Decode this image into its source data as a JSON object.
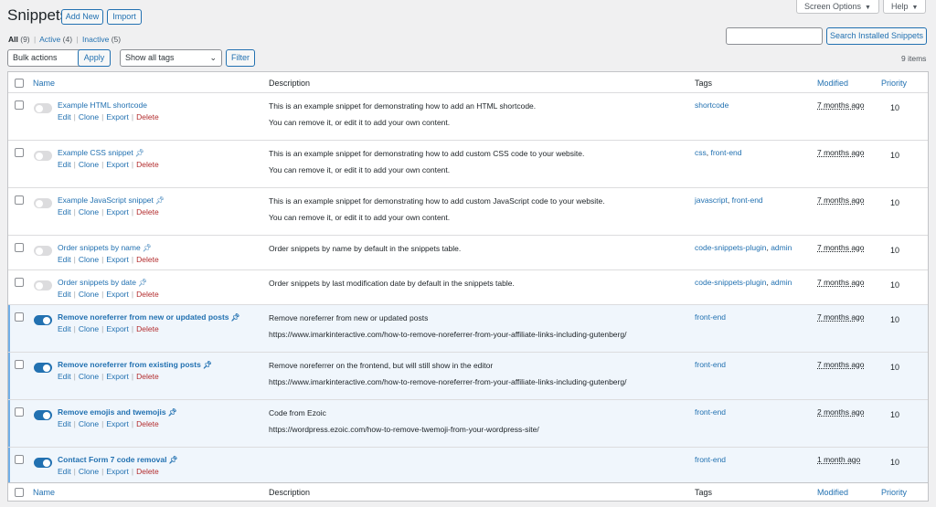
{
  "header": {
    "title": "Snippets",
    "add_new": "Add New",
    "import": "Import",
    "screen_options": "Screen Options",
    "help": "Help"
  },
  "views": {
    "all": "All",
    "all_count": "(9)",
    "active": "Active",
    "active_count": "(4)",
    "inactive": "Inactive",
    "inactive_count": "(5)"
  },
  "search": {
    "value": "",
    "button": "Search Installed Snippets"
  },
  "filters": {
    "bulk_actions": "Bulk actions",
    "apply": "Apply",
    "tags": "Show all tags",
    "filter": "Filter",
    "items_count": "9 items"
  },
  "columns": {
    "name": "Name",
    "description": "Description",
    "tags": "Tags",
    "modified": "Modified",
    "priority": "Priority"
  },
  "row_actions": {
    "edit": "Edit",
    "clone": "Clone",
    "export": "Export",
    "delete": "Delete"
  },
  "snippets": [
    {
      "name": "Example HTML shortcode",
      "active": false,
      "pinned": false,
      "desc1": "This is an example snippet for demonstrating how to add an HTML shortcode.",
      "desc2": "You can remove it, or edit it to add your own content.",
      "tag1": "shortcode",
      "tag2": "",
      "modified": "7 months ago",
      "priority": "10"
    },
    {
      "name": "Example CSS snippet",
      "active": false,
      "pinned": true,
      "desc1": "This is an example snippet for demonstrating how to add custom CSS code to your website.",
      "desc2": "You can remove it, or edit it to add your own content.",
      "tag1": "css",
      "tag2": "front-end",
      "modified": "7 months ago",
      "priority": "10"
    },
    {
      "name": "Example JavaScript snippet",
      "active": false,
      "pinned": true,
      "desc1": "This is an example snippet for demonstrating how to add custom JavaScript code to your website.",
      "desc2": "You can remove it, or edit it to add your own content.",
      "tag1": "javascript",
      "tag2": "front-end",
      "modified": "7 months ago",
      "priority": "10"
    },
    {
      "name": "Order snippets by name",
      "active": false,
      "pinned": true,
      "desc1": "Order snippets by name by default in the snippets table.",
      "desc2": "",
      "tag1": "code-snippets-plugin",
      "tag2": "admin",
      "modified": "7 months ago",
      "priority": "10"
    },
    {
      "name": "Order snippets by date",
      "active": false,
      "pinned": true,
      "desc1": "Order snippets by last modification date by default in the snippets table.",
      "desc2": "",
      "tag1": "code-snippets-plugin",
      "tag2": "admin",
      "modified": "7 months ago",
      "priority": "10"
    },
    {
      "name": "Remove noreferrer from new or updated posts",
      "active": true,
      "pinned": true,
      "desc1": "Remove noreferrer from new or updated posts",
      "desc2": "https://www.imarkinteractive.com/how-to-remove-noreferrer-from-your-affiliate-links-including-gutenberg/",
      "tag1": "front-end",
      "tag2": "",
      "modified": "7 months ago",
      "priority": "10"
    },
    {
      "name": "Remove noreferrer from existing posts",
      "active": true,
      "pinned": true,
      "desc1": "Remove noreferrer on the frontend, but will still show in the editor",
      "desc2": "https://www.imarkinteractive.com/how-to-remove-noreferrer-from-your-affiliate-links-including-gutenberg/",
      "tag1": "front-end",
      "tag2": "",
      "modified": "7 months ago",
      "priority": "10"
    },
    {
      "name": "Remove emojis and twemojis",
      "active": true,
      "pinned": true,
      "desc1": "Code from Ezoic",
      "desc2": "https://wordpress.ezoic.com/how-to-remove-twemoji-from-your-wordpress-site/",
      "tag1": "front-end",
      "tag2": "",
      "modified": "2 months ago",
      "priority": "10"
    },
    {
      "name": "Contact Form 7 code removal",
      "active": true,
      "pinned": true,
      "desc1": "",
      "desc2": "",
      "tag1": "front-end",
      "tag2": "",
      "modified": "1 month ago",
      "priority": "10"
    }
  ],
  "colors": {
    "accent": "#2271b1",
    "delete": "#b32d2e",
    "active_row_bg": "#f0f6fc",
    "active_border": "#72aee6"
  }
}
